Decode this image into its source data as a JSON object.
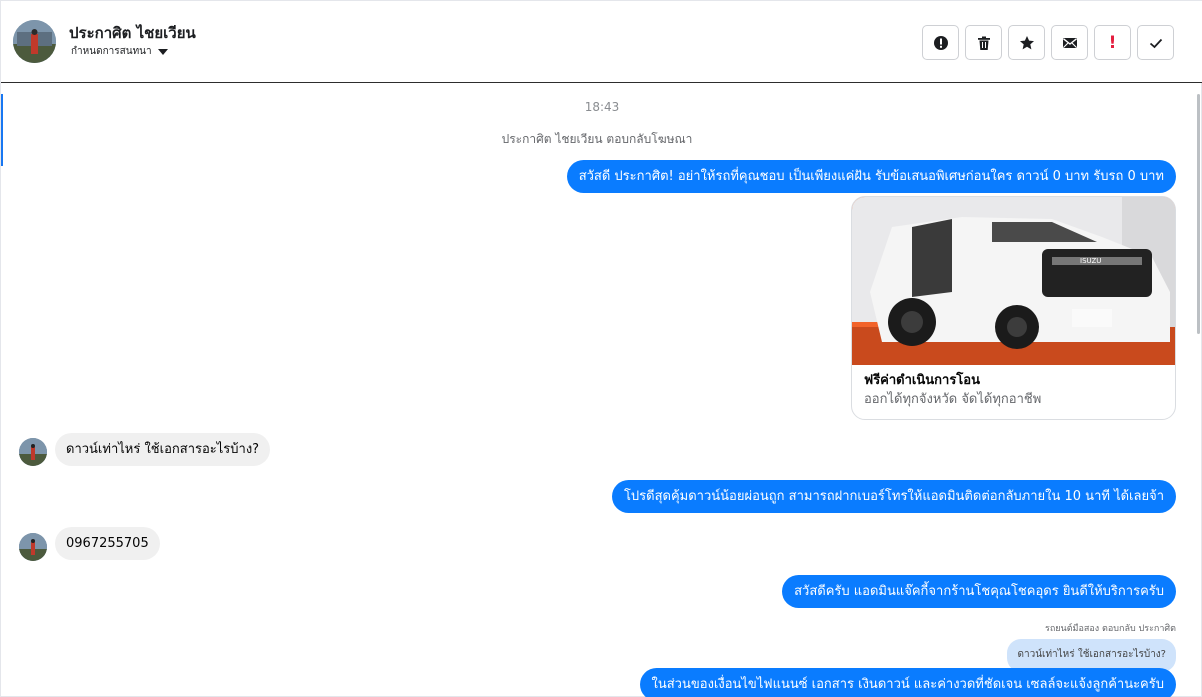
{
  "header": {
    "contact_name": "ประกาศิต ไชยเวียน",
    "conversation_action": "กำหนดการสนทนา"
  },
  "toolbar": [
    {
      "name": "spam-report-button",
      "icon": "alert-circle-icon"
    },
    {
      "name": "delete-button",
      "icon": "trash-icon"
    },
    {
      "name": "star-button",
      "icon": "star-icon"
    },
    {
      "name": "mark-unread-button",
      "icon": "mail-icon"
    },
    {
      "name": "follow-up-button",
      "icon": "exclamation-icon"
    },
    {
      "name": "mark-done-button",
      "icon": "check-icon"
    }
  ],
  "thread": {
    "timestamp": "18:43",
    "system_note": "ประกาศิต ไชยเวียน ตอบกลับโฆษณา",
    "messages": [
      {
        "from": "page",
        "text": "สวัสดี ประกาศิต! อย่าให้รถที่คุณชอบ เป็นเพียงแค่ฝัน รับข้อเสนอพิเศษก่อนใคร ดาวน์ 0 บาท รับรถ 0 บาท"
      },
      {
        "from": "page",
        "type": "card",
        "title": "ฟรีค่าดำเนินการโอน",
        "subtitle": "ออกได้ทุกจังหวัด จัดได้ทุกอาชีพ"
      },
      {
        "from": "customer",
        "text": "ดาวน์เท่าไหร่ ใช้เอกสารอะไรบ้าง?"
      },
      {
        "from": "page",
        "text": "โปรดีสุดคุ้มดาวน์น้อยผ่อนถูก สามารถฝากเบอร์โทรให้แอดมินติดต่อกลับภายใน 10 นาที ได้เลยจ้า"
      },
      {
        "from": "customer",
        "text": "0967255705"
      },
      {
        "from": "page",
        "text": "สวัสดีครับ แอดมินแจ๊คกี้จากร้านโชคุณโชคอุดร ยินดีให้บริการครับ"
      },
      {
        "from": "page",
        "type": "reply_note",
        "text": "รถยนต์มือสอง ตอบกลับ ประกาศิต"
      },
      {
        "from": "page",
        "type": "quoted",
        "text": "ดาวน์เท่าไหร่ ใช้เอกสารอะไรบ้าง?"
      },
      {
        "from": "page",
        "text": "ในส่วนของเงื่อนไขไฟแนนซ์ เอกสาร เงินดาวน์ และค่างวดที่ชัดเจน เซลล์จะแจ้งลูกค้านะครับ"
      }
    ]
  },
  "colors": {
    "outgoing_bubble": "#0a7cff",
    "incoming_bubble": "#f0f0f0",
    "card_accent": "#f2632a"
  }
}
